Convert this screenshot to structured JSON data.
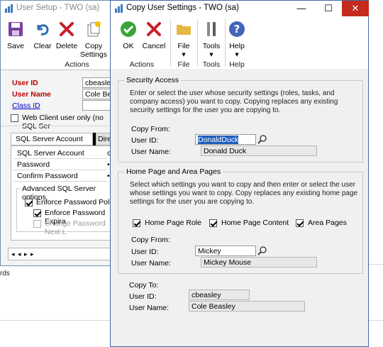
{
  "background": {
    "fragment_text": "rds"
  },
  "user_setup": {
    "title": "User Setup  -  TWO (sa)",
    "toolbar": {
      "save": "Save",
      "clear": "Clear",
      "delete": "Delete",
      "copy_settings_1": "Copy",
      "copy_settings_2": "Settings",
      "group_label": "Actions"
    },
    "fields": {
      "user_id_label": "User ID",
      "user_id_value": "cbeasley",
      "user_name_label": "User Name",
      "user_name_value": "Cole Beas",
      "class_id_label": "Class ID",
      "web_client_label": "Web Client user only (no SQL Ser"
    },
    "tabs": {
      "sql_server_account": "SQL Server Account",
      "directory": "Direc"
    },
    "account": {
      "sql_server_account_label": "SQL Server Account",
      "password_label": "Password",
      "confirm_password_label": "Confirm Password",
      "advanced_label": "Advanced SQL Server options",
      "enforce_password_policy": "Enforce Password Policy",
      "enforce_password_expiration": "Enforce Password Expira",
      "change_password_next": "Change Password Next L"
    },
    "nav_glyph": "◂ ◂ ▸ ▸"
  },
  "dialog": {
    "title": "Copy User Settings  -  TWO (sa)",
    "window_buttons": {
      "minimize": "—",
      "maximize": "☐",
      "close": "✕"
    },
    "toolbar": {
      "ok": "OK",
      "cancel": "Cancel",
      "actions_group": "Actions",
      "file": "File",
      "file_group": "File",
      "tools": "Tools",
      "tools_group": "Tools",
      "help": "Help",
      "help_group": "Help",
      "dropdown_glyph": "▾"
    },
    "security_access": {
      "title": "Security Access",
      "description": "Enter or select the user whose security settings (roles, tasks, and company access) you want to copy. Copying replaces any existing security settings for the user you are copying to.",
      "copy_from_label": "Copy From:",
      "user_id_label": "User ID:",
      "user_id_value": "DonaldDuck",
      "user_name_label": "User Name:",
      "user_name_value": "Donald Duck"
    },
    "home_page": {
      "title": "Home Page and Area Pages",
      "description": "Select which settings you want to copy and then enter or select the user whose settings you want to copy. Copy replaces any existing home page settings for the user you are copying to.",
      "home_page_role": "Home Page Role",
      "home_page_content": "Home Page Content",
      "area_pages": "Area Pages",
      "copy_from_label": "Copy From:",
      "user_id_label": "User ID:",
      "user_id_value": "Mickey",
      "user_name_label": "User Name:",
      "user_name_value": "Mickey Mouse"
    },
    "copy_to": {
      "label": "Copy To:",
      "user_id_label": "User ID:",
      "user_id_value": "cbeasley",
      "user_name_label": "User Name:",
      "user_name_value": "Cole Beasley"
    }
  }
}
